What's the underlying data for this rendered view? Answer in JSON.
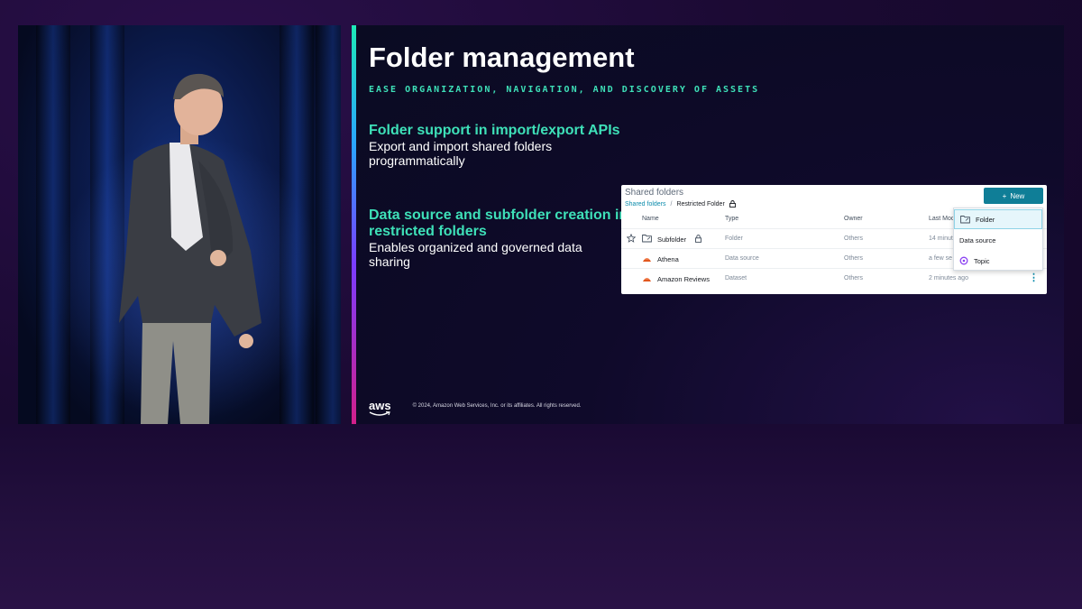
{
  "slide": {
    "title": "Folder management",
    "subtitle": "EASE ORGANIZATION, NAVIGATION, AND DISCOVERY OF ASSETS",
    "section1": {
      "heading": "Folder support in import/export APIs",
      "body": "Export and import shared folders programmatically"
    },
    "section2": {
      "heading": "Data source and subfolder creation in restricted folders",
      "body": "Enables organized and governed data sharing"
    },
    "footer": {
      "logo": "aws",
      "copyright": "© 2024, Amazon Web Services, Inc. or its affiliates. All rights reserved."
    }
  },
  "screenshot": {
    "title": "Shared folders",
    "breadcrumb": {
      "root": "Shared folders",
      "separator": "/",
      "current": "Restricted Folder"
    },
    "new_button": "New",
    "columns": {
      "name": "Name",
      "type": "Type",
      "owner": "Owner",
      "modified": "Last Mod"
    },
    "rows": [
      {
        "name": "Subfolder",
        "type": "Folder",
        "owner": "Others",
        "modified": "14 minut",
        "icon": "folder-icon"
      },
      {
        "name": "Athena",
        "type": "Data source",
        "owner": "Others",
        "modified": "a few se",
        "icon": "athena-icon"
      },
      {
        "name": "Amazon Reviews",
        "type": "Dataset",
        "owner": "Others",
        "modified": "2 minutes ago",
        "icon": "dataset-icon"
      }
    ],
    "dropdown": [
      {
        "label": "Folder",
        "icon": "folder-icon",
        "active": true
      },
      {
        "label": "Data source",
        "icon": "",
        "active": false
      },
      {
        "label": "Topic",
        "icon": "topic-icon",
        "active": false
      }
    ]
  },
  "colors": {
    "accent_teal": "#3ee0b8",
    "button_teal": "#0f7e97",
    "link_teal": "#0a8bab",
    "background": "#1b0a33"
  }
}
